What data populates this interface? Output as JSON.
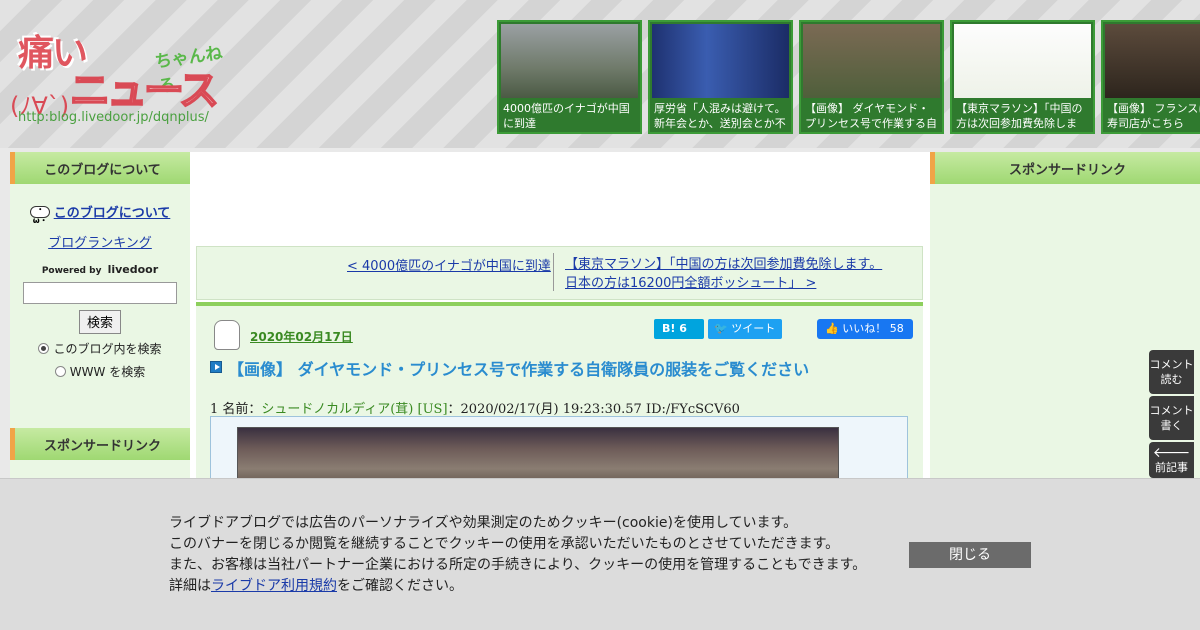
{
  "header": {
    "logo": {
      "main": "痛い",
      "sub": "ニュース",
      "deco": "ちゃんねる",
      "face": "(ﾉ∀`)",
      "url": "http:blog.livedoor.jp/dqnplus/"
    },
    "thumbnails": [
      {
        "caption": "4000億匹のイナゴが中国に到達"
      },
      {
        "caption": "厚労省「人混みは避けて。新年会とか、送別会とか不"
      },
      {
        "caption": "【画像】 ダイヤモンド・プリンセス号で作業する自衛"
      },
      {
        "caption": "【東京マラソン】「中国の方は次回参加費免除しま"
      },
      {
        "caption": "【画像】 フランスに本の寿司店がこちら"
      }
    ]
  },
  "sidebar_left": {
    "heading": "このブログについて",
    "about_link": "このブログについて",
    "ranking_link": "ブログランキング",
    "powered_by": "Powered by",
    "powered_brand": "livedoor",
    "search_value": "",
    "search_button": "検索",
    "radio_blog": "このブログ内を検索",
    "radio_www": "WWW を検索",
    "sponsor_heading": "スポンサードリンク"
  },
  "sidebar_right": {
    "sponsor_heading": "スポンサードリンク"
  },
  "nav": {
    "prev": "< 4000億匹のイナゴが中国に到達",
    "next_line1": "【東京マラソン】「中国の方は次回参加費免除します。",
    "next_line2": "日本の方は16200円全額ボッシュート」 >"
  },
  "article": {
    "date": "2020年02月17日",
    "hatena_label": "B! 6",
    "tweet_label": "ツイート",
    "like_label": "いいね！ 58",
    "title": "【画像】 ダイヤモンド・プリンセス号で作業する自衛隊員の服装をご覧ください",
    "meta_prefix": "1 名前：",
    "meta_name": "シュードノカルディア(茸) [US]",
    "meta_suffix": "：2020/02/17(月) 19:23:30.57 ID:/FYcSCV60"
  },
  "float_buttons": {
    "read": "コメント読む",
    "write": "コメント書く",
    "prev": "前記事"
  },
  "cookie": {
    "line1": "ライブドアブログでは広告のパーソナライズや効果測定のためクッキー(cookie)を使用しています。",
    "line2": "このバナーを閉じるか閲覧を継続することでクッキーの使用を承認いただいたものとさせていただきます。",
    "line3": "また、お客様は当社パートナー企業における所定の手続きにより、クッキーの使用を管理することもできます。",
    "line4_prefix": "詳細は",
    "line4_link": "ライブドア利用規約",
    "line4_suffix": "をご確認ください。",
    "close": "閉じる"
  }
}
